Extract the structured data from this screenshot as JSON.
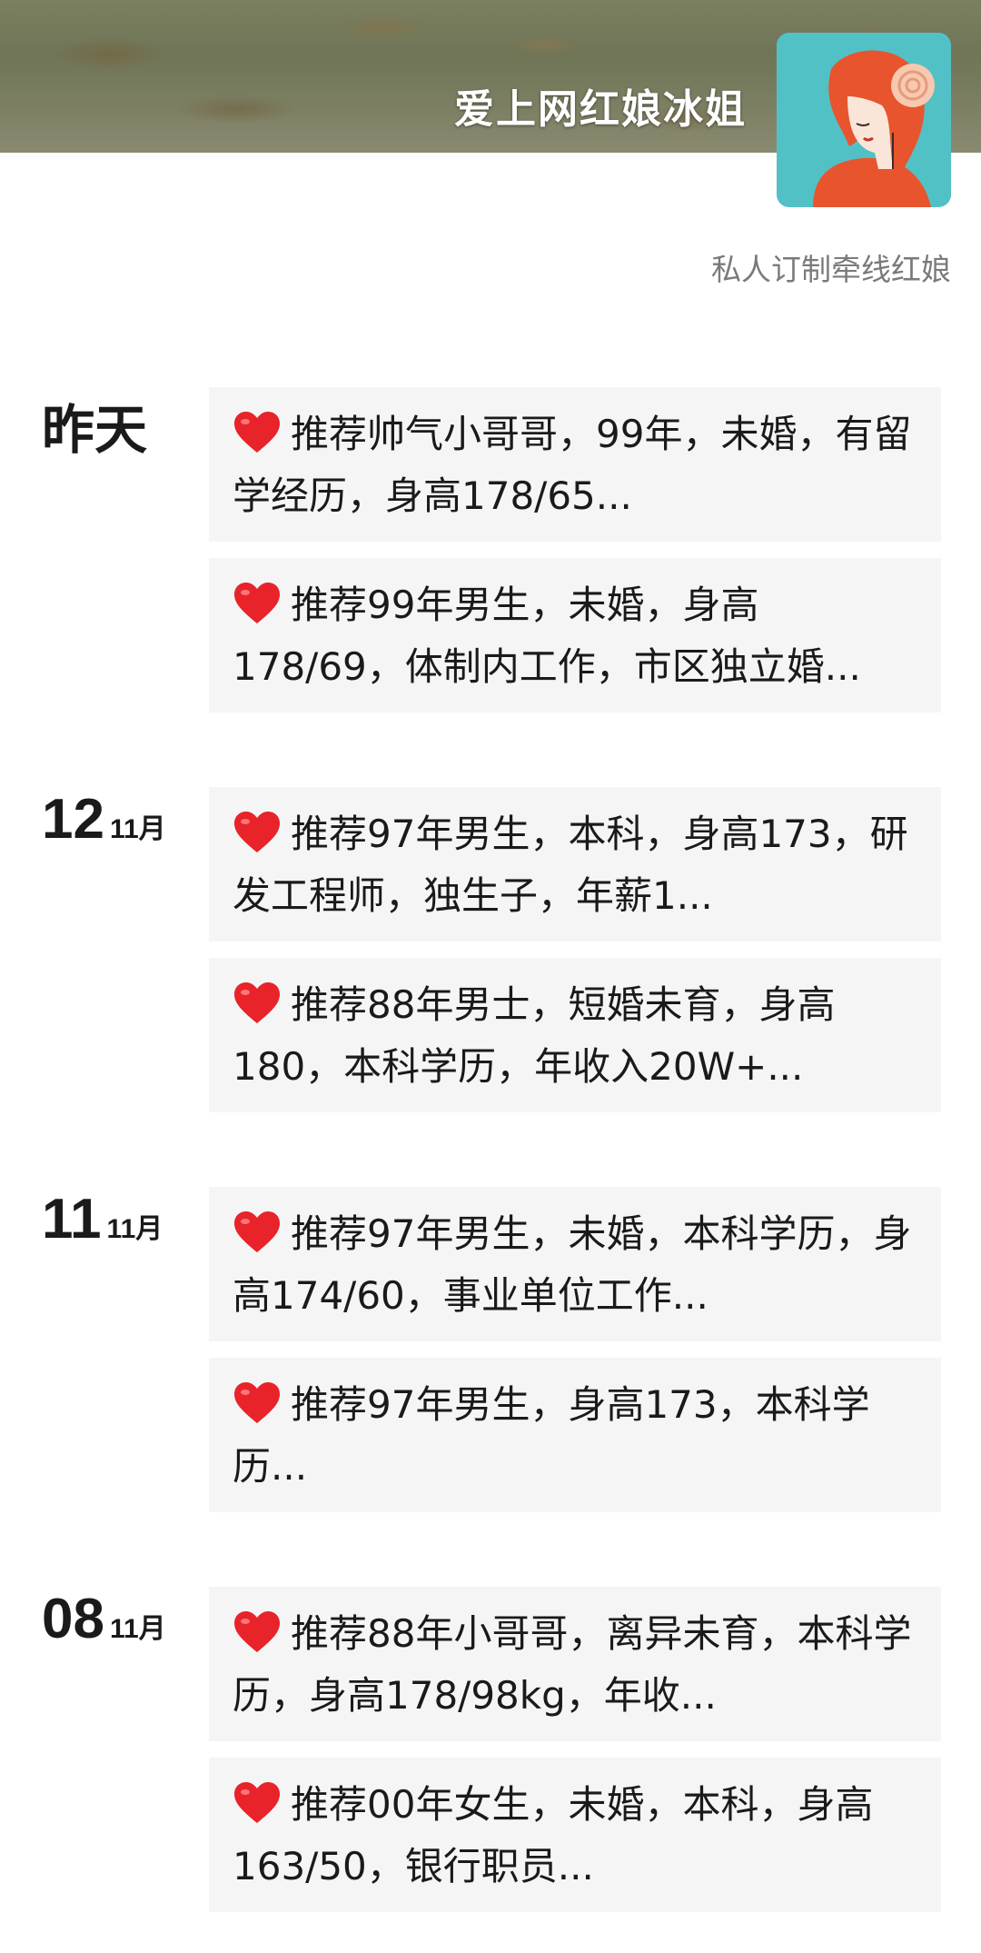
{
  "header": {
    "title": "爱上网红娘冰姐",
    "subtitle": "私人订制牵线红娘"
  },
  "colors": {
    "heart": "#e8232a",
    "card_bg": "#f5f5f5",
    "avatar_bg": "#52c1c6"
  },
  "days": [
    {
      "day": "昨天",
      "month": "",
      "posts": [
        {
          "icon": "heart-icon",
          "text": "推荐帅气小哥哥，99年，未婚，有留学经历，身高178/65..."
        },
        {
          "icon": "heart-icon",
          "text": "推荐99年男生，未婚，身高178/69，体制内工作，市区独立婚..."
        }
      ]
    },
    {
      "day": "12",
      "month": "11月",
      "posts": [
        {
          "icon": "heart-icon",
          "text": "推荐97年男生，本科，身高173，研发工程师，独生子，年薪1..."
        },
        {
          "icon": "heart-icon",
          "text": "推荐88年男士，短婚未育，身高180，本科学历，年收入20W+..."
        }
      ]
    },
    {
      "day": "11",
      "month": "11月",
      "posts": [
        {
          "icon": "heart-icon",
          "text": "推荐97年男生，未婚，本科学历，身高174/60，事业单位工作..."
        },
        {
          "icon": "heart-icon",
          "text": "推荐97年男生，身高173，本科学历..."
        }
      ]
    },
    {
      "day": "08",
      "month": "11月",
      "posts": [
        {
          "icon": "heart-icon",
          "text": "推荐88年小哥哥，离异未育，本科学历，身高178/98kg，年收..."
        },
        {
          "icon": "heart-icon",
          "text": "推荐00年女生，未婚，本科，身高163/50，银行职员..."
        }
      ]
    }
  ]
}
